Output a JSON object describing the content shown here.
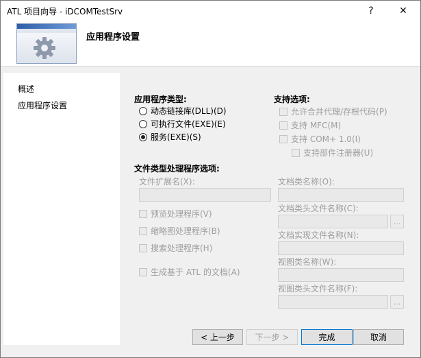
{
  "window": {
    "title": "ATL 项目向导 - iDCOMTestSrv",
    "help_label": "?",
    "close_label": "✕"
  },
  "header": {
    "title": "应用程序设置"
  },
  "sidebar": {
    "items": [
      {
        "label": "概述"
      },
      {
        "label": "应用程序设置"
      }
    ]
  },
  "app_type": {
    "title": "应用程序类型:",
    "options": [
      {
        "label": "动态链接库(DLL)(D)",
        "selected": false
      },
      {
        "label": "可执行文件(EXE)(E)",
        "selected": false
      },
      {
        "label": "服务(EXE)(S)",
        "selected": true
      }
    ]
  },
  "support": {
    "title": "支持选项:",
    "options": [
      {
        "label": "允许合并代理/存根代码(P)",
        "checked": false
      },
      {
        "label": "支持 MFC(M)",
        "checked": false
      },
      {
        "label": "支持 COM+ 1.0(I)",
        "checked": false
      },
      {
        "label": "支持部件注册器(U)",
        "checked": false
      }
    ]
  },
  "file_type": {
    "title": "文件类型处理程序选项:",
    "ext_label": "文件扩展名(X):",
    "ext_value": "",
    "handlers": [
      {
        "label": "预览处理程序(V)",
        "checked": false
      },
      {
        "label": "缩略图处理程序(B)",
        "checked": false
      },
      {
        "label": "搜索处理程序(H)",
        "checked": false
      }
    ],
    "atl_doc_label": "生成基于 ATL 的文档(A)",
    "doc_class_label": "文档类名称(O):",
    "doc_header_label": "文档类头文件名称(C):",
    "doc_impl_label": "文档实现文件名称(N):",
    "view_class_label": "视图类名称(W):",
    "view_header_label": "视图类头文件名称(F):",
    "browse_label": "..."
  },
  "footer": {
    "prev_label": "< 上一步",
    "next_label": "下一步 >",
    "finish_label": "完成",
    "cancel_label": "取消"
  }
}
